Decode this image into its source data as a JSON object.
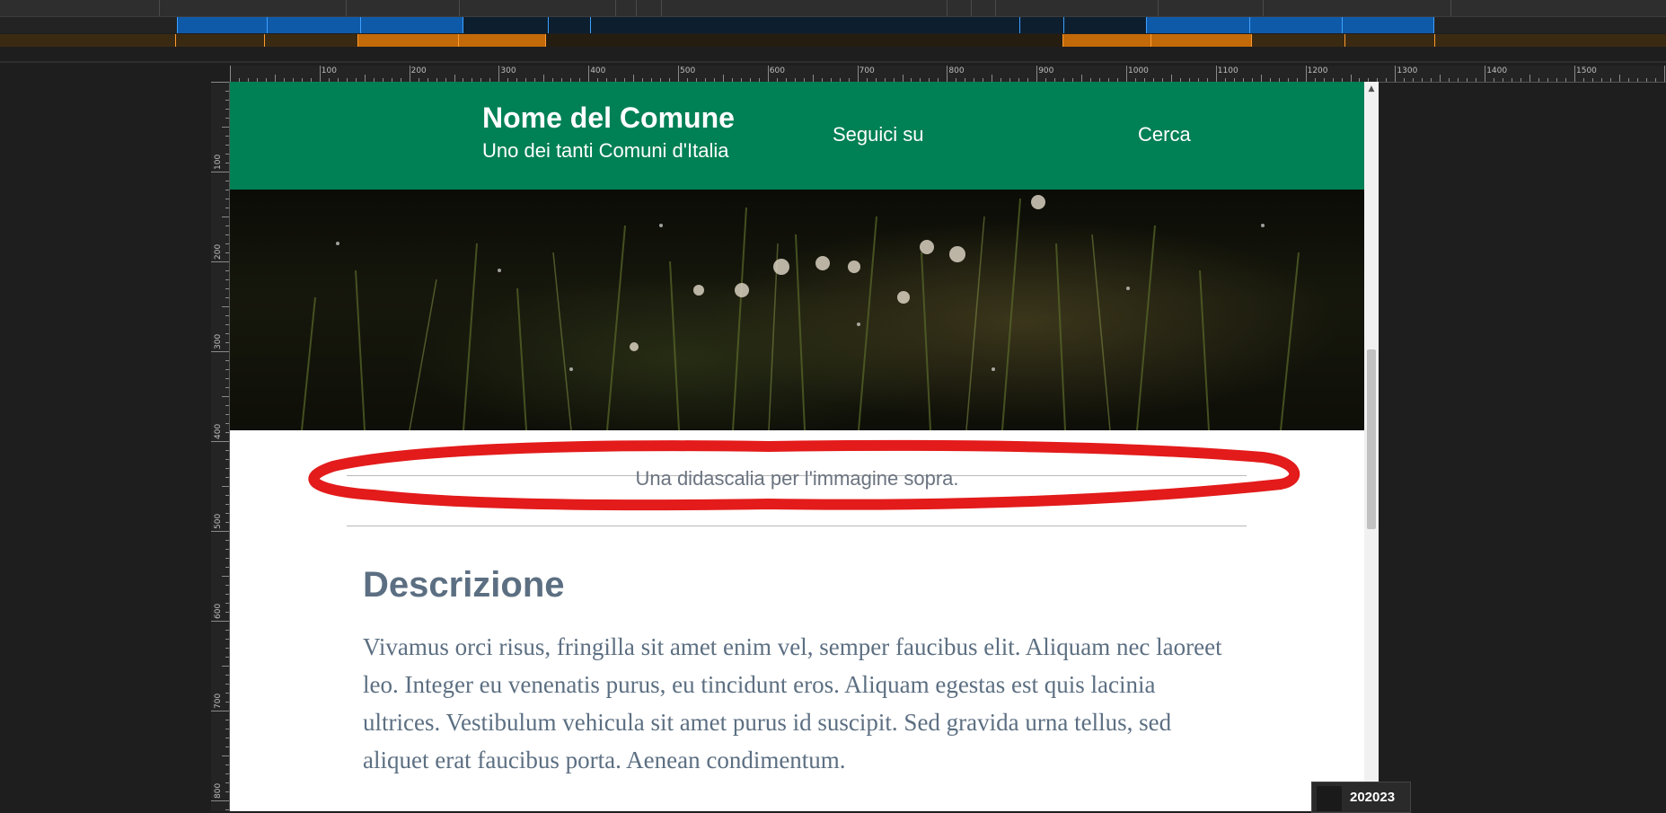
{
  "site": {
    "title": "Nome del Comune",
    "subtitle": "Uno dei tanti Comuni d'Italia"
  },
  "nav": {
    "social": "Seguici su",
    "search": "Cerca"
  },
  "figure": {
    "caption": "Una didascalia per l'immagine sopra."
  },
  "section": {
    "heading": "Descrizione",
    "body": "Vivamus orci risus, fringilla sit amet enim vel, semper faucibus elit. Aliquam nec laoreet leo. Integer eu venenatis purus, eu tincidunt eros. Aliquam egestas est quis lacinia ultrices. Vestibulum vehicula sit amet purus id suscipit. Sed gravida urna tellus, sed aliquet erat faucibus porta. Aenean condimentum."
  },
  "ruler": {
    "horizontal_labels": [
      "100",
      "200",
      "300",
      "400",
      "500",
      "600",
      "700",
      "800",
      "900",
      "1000",
      "1100",
      "1200",
      "1300",
      "1400",
      "1500"
    ],
    "vertical_labels": [
      "100",
      "200",
      "300",
      "400",
      "500",
      "600",
      "700",
      "800"
    ]
  },
  "badge": {
    "label": "202023"
  },
  "colors": {
    "header_bg": "#008055",
    "heading_text": "#5c6f82",
    "annotation_red": "#e31b1b",
    "mq_blue": "#0f5aa8",
    "mq_orange": "#c26a0a"
  }
}
